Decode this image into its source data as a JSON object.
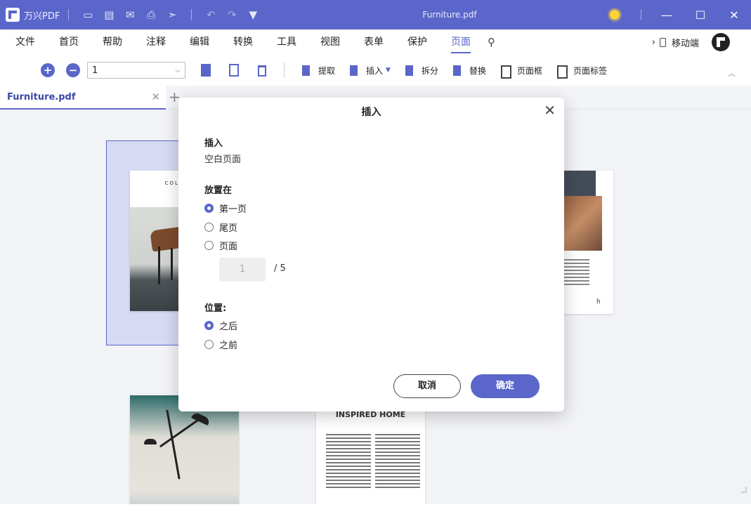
{
  "titlebar": {
    "app_name": "万兴PDF",
    "document_title": "Furniture.pdf",
    "colors": {
      "brand": "#5a66c9",
      "titlebar_bg": "#5a66c9"
    },
    "icons": [
      "folder-icon",
      "save-icon",
      "mail-icon",
      "print-icon",
      "share-icon",
      "undo-icon",
      "redo-icon",
      "quick-access-dropdown-icon"
    ],
    "window_buttons": {
      "minimize": "—",
      "maximize": "☐",
      "close": "✕"
    }
  },
  "menu": {
    "items": [
      "文件",
      "首页",
      "帮助",
      "注释",
      "编辑",
      "转换",
      "工具",
      "视图",
      "表单",
      "保护",
      "页面"
    ],
    "active": "页面",
    "mobile_label": "移动端"
  },
  "toolbar": {
    "page_field": "1",
    "buttons": {
      "extract": "提取",
      "insert": "插入",
      "split": "拆分",
      "replace": "替换",
      "page_box": "页面框",
      "page_label": "页面标签"
    }
  },
  "tabs": {
    "doc_tab": "Furniture.pdf"
  },
  "thumbnails": {
    "page1_text": "COL COLL",
    "page2_letter": "h",
    "page4_title": "INSPIRED HOME"
  },
  "dialog": {
    "title": "插入",
    "insert_label": "插入",
    "insert_value": "空白页面",
    "place_label": "放置在",
    "place_options": {
      "first": "第一页",
      "last": "尾页",
      "page": "页面"
    },
    "place_selected": "第一页",
    "page_number": "1",
    "page_total": "/ 5",
    "position_label": "位置:",
    "position_options": {
      "after": "之后",
      "before": "之前"
    },
    "position_selected": "之后",
    "cancel_label": "取消",
    "ok_label": "确定"
  }
}
